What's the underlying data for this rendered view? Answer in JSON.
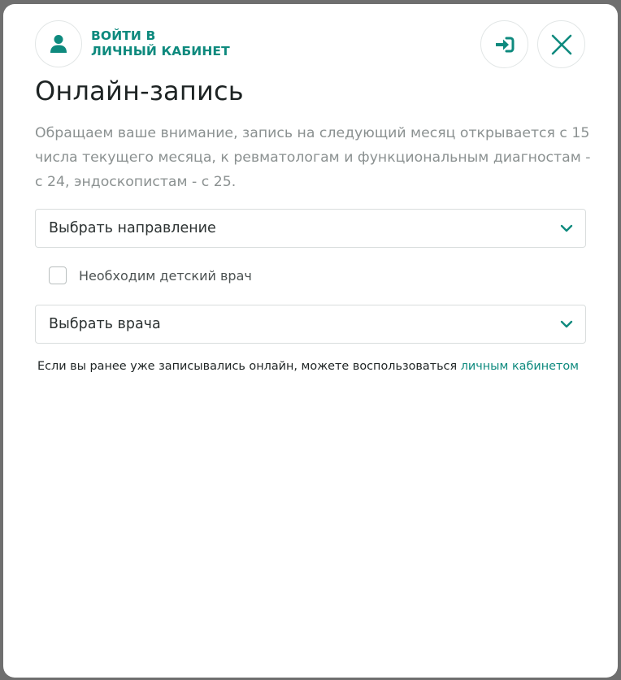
{
  "header": {
    "login_line1": "ВОЙТИ В",
    "login_line2": "ЛИЧНЫЙ КАБИНЕТ",
    "accent_color": "#0e8a7e",
    "icons": {
      "avatar": "user-icon",
      "enter": "sign-in-icon",
      "close": "close-icon"
    }
  },
  "main": {
    "title": "Онлайн-запись",
    "notice": "Обращаем ваше внимание, запись на следующий месяц открывается с 15 числа текущего месяца, к ревматологам и функциональным диагностам - с 24, эндоскопистам - с 25.",
    "direction_select": "Выбрать направление",
    "child_doctor_checkbox": "Необходим детский врач",
    "doctor_select": "Выбрать врача",
    "footer_text": "Если вы ранее уже записывались онлайн, можете воспользоваться ",
    "footer_link": "личным кабинетом"
  }
}
